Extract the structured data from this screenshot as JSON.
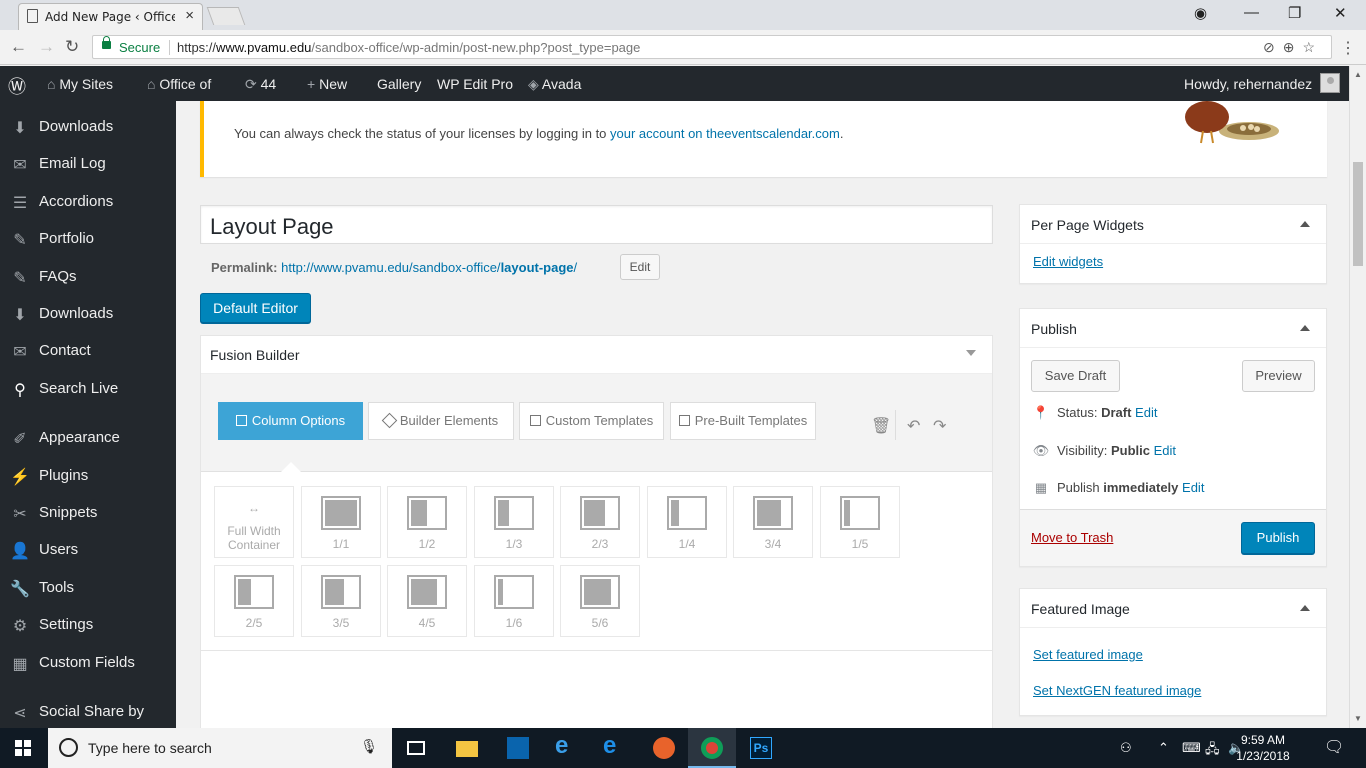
{
  "browser": {
    "tab_title": "Add New Page ‹ Office o",
    "secure_label": "Secure",
    "url_scheme": "https://",
    "url_host": "www.pvamu.edu",
    "url_path": "/sandbox-office/wp-admin/post-new.php?post_type=page"
  },
  "adminbar": {
    "my_sites": "My Sites",
    "site_name": "Office of",
    "updates_count": "44",
    "new_label": "New",
    "gallery": "Gallery",
    "wp_edit_pro": "WP Edit Pro",
    "avada": "Avada",
    "howdy": "Howdy, rehernandez"
  },
  "sidebar": {
    "items": [
      {
        "label": "Downloads",
        "icon": "download-icon"
      },
      {
        "label": "Email Log",
        "icon": "mail-icon"
      },
      {
        "label": "Accordions",
        "icon": "list-icon"
      },
      {
        "label": "Portfolio",
        "icon": "pin-icon"
      },
      {
        "label": "FAQs",
        "icon": "pin-icon"
      },
      {
        "label": "Downloads",
        "icon": "download-icon"
      },
      {
        "label": "Contact",
        "icon": "mail-icon"
      },
      {
        "label": "Search Live",
        "icon": "search-icon"
      },
      {
        "label": "Appearance",
        "icon": "brush-icon"
      },
      {
        "label": "Plugins",
        "icon": "plugin-icon"
      },
      {
        "label": "Snippets",
        "icon": "scissors-icon"
      },
      {
        "label": "Users",
        "icon": "user-icon"
      },
      {
        "label": "Tools",
        "icon": "wrench-icon"
      },
      {
        "label": "Settings",
        "icon": "sliders-icon"
      },
      {
        "label": "Custom Fields",
        "icon": "grid-icon"
      },
      {
        "label": "Social Share by",
        "icon": "share-icon"
      }
    ]
  },
  "notice": {
    "text": "You can always check the status of your licenses by logging in to ",
    "link": "your account on theeventscalendar.com",
    "suffix": "."
  },
  "editor": {
    "title_value": "Layout Page",
    "permalink_label": "Permalink:",
    "permalink_base": "http://www.pvamu.edu/sandbox-office/",
    "permalink_slug": "layout-page",
    "permalink_trail": "/",
    "edit_button": "Edit",
    "default_editor_button": "Default Editor"
  },
  "fusion": {
    "title": "Fusion Builder",
    "tabs": [
      "Column Options",
      "Builder Elements",
      "Custom Templates",
      "Pre-Built Templates"
    ],
    "full_width_label": "Full Width Container",
    "full_width_arrow": "↔",
    "columns": [
      {
        "label": "1/1",
        "fill": 1.0
      },
      {
        "label": "1/2",
        "fill": 0.5
      },
      {
        "label": "1/3",
        "fill": 0.333
      },
      {
        "label": "2/3",
        "fill": 0.667
      },
      {
        "label": "1/4",
        "fill": 0.25
      },
      {
        "label": "3/4",
        "fill": 0.75
      },
      {
        "label": "1/5",
        "fill": 0.2
      },
      {
        "label": "2/5",
        "fill": 0.4
      },
      {
        "label": "3/5",
        "fill": 0.6
      },
      {
        "label": "4/5",
        "fill": 0.8
      },
      {
        "label": "1/6",
        "fill": 0.167
      },
      {
        "label": "5/6",
        "fill": 0.833
      }
    ]
  },
  "widgets_box": {
    "title": "Per Page Widgets",
    "link": "Edit widgets"
  },
  "publish_box": {
    "title": "Publish",
    "save_draft": "Save Draft",
    "preview": "Preview",
    "status_label": "Status: ",
    "status_value": "Draft",
    "visibility_label": "Visibility: ",
    "visibility_value": "Public",
    "publish_label": "Publish ",
    "publish_value": "immediately",
    "edit_link": "Edit",
    "trash": "Move to Trash",
    "publish_button": "Publish"
  },
  "featured_box": {
    "title": "Featured Image",
    "set_featured": "Set featured image",
    "set_nextgen": "Set NextGEN featured image"
  },
  "taskbar": {
    "search_placeholder": "Type here to search",
    "time": "9:59 AM",
    "date": "1/23/2018"
  },
  "colors": {
    "accent": "#0085ba",
    "admin_dark": "#23282d",
    "notice_warning": "#ffb900",
    "fusion_active": "#3da4d6"
  }
}
